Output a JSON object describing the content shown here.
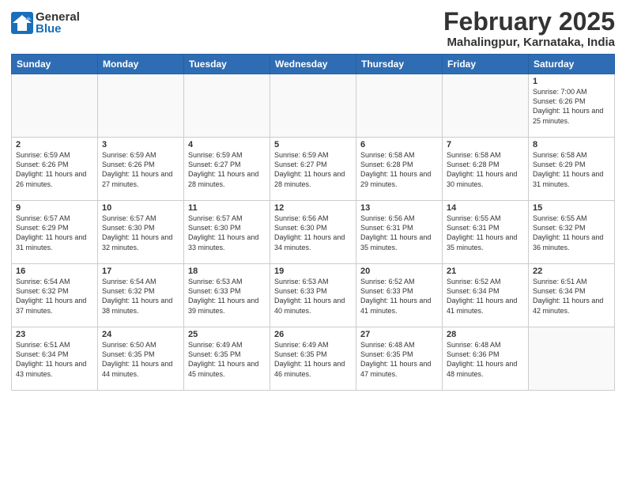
{
  "logo": {
    "general": "General",
    "blue": "Blue"
  },
  "title": {
    "month": "February 2025",
    "location": "Mahalingpur, Karnataka, India"
  },
  "headers": [
    "Sunday",
    "Monday",
    "Tuesday",
    "Wednesday",
    "Thursday",
    "Friday",
    "Saturday"
  ],
  "weeks": [
    [
      {
        "day": "",
        "info": ""
      },
      {
        "day": "",
        "info": ""
      },
      {
        "day": "",
        "info": ""
      },
      {
        "day": "",
        "info": ""
      },
      {
        "day": "",
        "info": ""
      },
      {
        "day": "",
        "info": ""
      },
      {
        "day": "1",
        "info": "Sunrise: 7:00 AM\nSunset: 6:26 PM\nDaylight: 11 hours and 25 minutes."
      }
    ],
    [
      {
        "day": "2",
        "info": "Sunrise: 6:59 AM\nSunset: 6:26 PM\nDaylight: 11 hours and 26 minutes."
      },
      {
        "day": "3",
        "info": "Sunrise: 6:59 AM\nSunset: 6:26 PM\nDaylight: 11 hours and 27 minutes."
      },
      {
        "day": "4",
        "info": "Sunrise: 6:59 AM\nSunset: 6:27 PM\nDaylight: 11 hours and 28 minutes."
      },
      {
        "day": "5",
        "info": "Sunrise: 6:59 AM\nSunset: 6:27 PM\nDaylight: 11 hours and 28 minutes."
      },
      {
        "day": "6",
        "info": "Sunrise: 6:58 AM\nSunset: 6:28 PM\nDaylight: 11 hours and 29 minutes."
      },
      {
        "day": "7",
        "info": "Sunrise: 6:58 AM\nSunset: 6:28 PM\nDaylight: 11 hours and 30 minutes."
      },
      {
        "day": "8",
        "info": "Sunrise: 6:58 AM\nSunset: 6:29 PM\nDaylight: 11 hours and 31 minutes."
      }
    ],
    [
      {
        "day": "9",
        "info": "Sunrise: 6:57 AM\nSunset: 6:29 PM\nDaylight: 11 hours and 31 minutes."
      },
      {
        "day": "10",
        "info": "Sunrise: 6:57 AM\nSunset: 6:30 PM\nDaylight: 11 hours and 32 minutes."
      },
      {
        "day": "11",
        "info": "Sunrise: 6:57 AM\nSunset: 6:30 PM\nDaylight: 11 hours and 33 minutes."
      },
      {
        "day": "12",
        "info": "Sunrise: 6:56 AM\nSunset: 6:30 PM\nDaylight: 11 hours and 34 minutes."
      },
      {
        "day": "13",
        "info": "Sunrise: 6:56 AM\nSunset: 6:31 PM\nDaylight: 11 hours and 35 minutes."
      },
      {
        "day": "14",
        "info": "Sunrise: 6:55 AM\nSunset: 6:31 PM\nDaylight: 11 hours and 35 minutes."
      },
      {
        "day": "15",
        "info": "Sunrise: 6:55 AM\nSunset: 6:32 PM\nDaylight: 11 hours and 36 minutes."
      }
    ],
    [
      {
        "day": "16",
        "info": "Sunrise: 6:54 AM\nSunset: 6:32 PM\nDaylight: 11 hours and 37 minutes."
      },
      {
        "day": "17",
        "info": "Sunrise: 6:54 AM\nSunset: 6:32 PM\nDaylight: 11 hours and 38 minutes."
      },
      {
        "day": "18",
        "info": "Sunrise: 6:53 AM\nSunset: 6:33 PM\nDaylight: 11 hours and 39 minutes."
      },
      {
        "day": "19",
        "info": "Sunrise: 6:53 AM\nSunset: 6:33 PM\nDaylight: 11 hours and 40 minutes."
      },
      {
        "day": "20",
        "info": "Sunrise: 6:52 AM\nSunset: 6:33 PM\nDaylight: 11 hours and 41 minutes."
      },
      {
        "day": "21",
        "info": "Sunrise: 6:52 AM\nSunset: 6:34 PM\nDaylight: 11 hours and 41 minutes."
      },
      {
        "day": "22",
        "info": "Sunrise: 6:51 AM\nSunset: 6:34 PM\nDaylight: 11 hours and 42 minutes."
      }
    ],
    [
      {
        "day": "23",
        "info": "Sunrise: 6:51 AM\nSunset: 6:34 PM\nDaylight: 11 hours and 43 minutes."
      },
      {
        "day": "24",
        "info": "Sunrise: 6:50 AM\nSunset: 6:35 PM\nDaylight: 11 hours and 44 minutes."
      },
      {
        "day": "25",
        "info": "Sunrise: 6:49 AM\nSunset: 6:35 PM\nDaylight: 11 hours and 45 minutes."
      },
      {
        "day": "26",
        "info": "Sunrise: 6:49 AM\nSunset: 6:35 PM\nDaylight: 11 hours and 46 minutes."
      },
      {
        "day": "27",
        "info": "Sunrise: 6:48 AM\nSunset: 6:35 PM\nDaylight: 11 hours and 47 minutes."
      },
      {
        "day": "28",
        "info": "Sunrise: 6:48 AM\nSunset: 6:36 PM\nDaylight: 11 hours and 48 minutes."
      },
      {
        "day": "",
        "info": ""
      }
    ]
  ]
}
